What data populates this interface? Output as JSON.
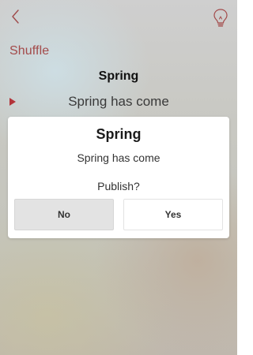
{
  "nav": {
    "back_icon": "chevron-left-icon",
    "hint_icon": "lightbulb-icon"
  },
  "list": {
    "shuffle_label": "Shuffle",
    "header_title": "Spring",
    "now_playing_icon": "play-icon",
    "now_playing_title": "Spring has come"
  },
  "dialog": {
    "title": "Spring",
    "subtitle": "Spring has come",
    "question": "Publish?",
    "no_label": "No",
    "yes_label": "Yes"
  },
  "colors": {
    "accent": "#a34a4a",
    "play": "#b3343a",
    "dialog_bg": "#ffffff"
  }
}
